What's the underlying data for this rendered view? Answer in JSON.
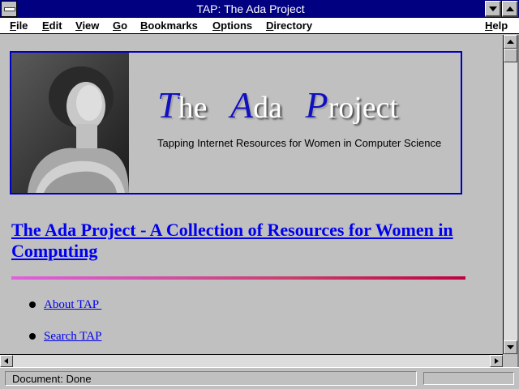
{
  "window": {
    "title": "TAP: The Ada Project"
  },
  "menubar": {
    "items": [
      {
        "label": "File"
      },
      {
        "label": "Edit"
      },
      {
        "label": "View"
      },
      {
        "label": "Go"
      },
      {
        "label": "Bookmarks"
      },
      {
        "label": "Options"
      },
      {
        "label": "Directory"
      },
      {
        "label": "Help"
      }
    ]
  },
  "banner": {
    "title_parts": [
      {
        "cap": "T",
        "rest": "he"
      },
      {
        "cap": "A",
        "rest": "da"
      },
      {
        "cap": "P",
        "rest": "roject"
      }
    ],
    "subtitle": "Tapping Internet Resources for Women in Computer Science"
  },
  "page": {
    "heading": "The Ada Project - A Collection of Resources for Women in Computing",
    "links": [
      {
        "label": "About TAP "
      },
      {
        "label": "Search TAP"
      }
    ]
  },
  "status": {
    "text": "Document: Done"
  },
  "colors": {
    "titlebar": "#000080",
    "link": "#0000ee",
    "banner_border": "#0000c0",
    "banner_caps": "#1010c0",
    "rule_start": "#e060e0",
    "rule_end": "#c00040"
  },
  "icons": {
    "system_menu": "system-menu-icon",
    "minimize": "minimize-arrow-icon",
    "maximize": "maximize-arrow-icon",
    "scroll_up": "scroll-up-arrow-icon",
    "scroll_down": "scroll-down-arrow-icon",
    "scroll_left": "scroll-left-arrow-icon",
    "scroll_right": "scroll-right-arrow-icon"
  }
}
